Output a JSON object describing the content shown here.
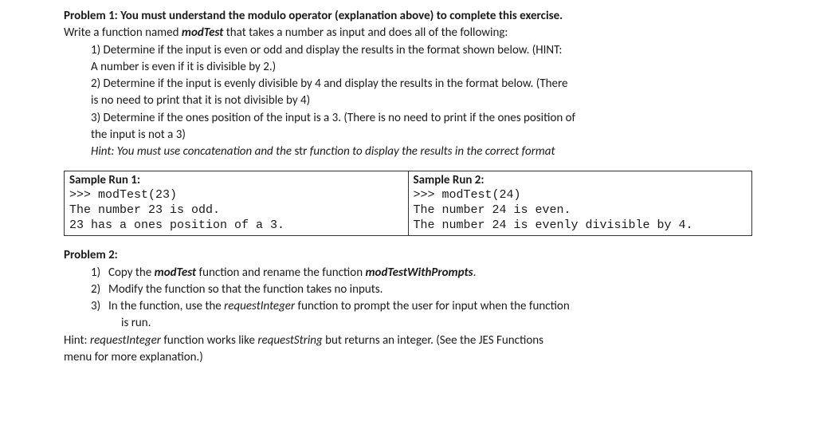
{
  "p1": {
    "title_lead": "Problem 1:  ",
    "title_rest": "You must understand the modulo operator (explanation above) to complete this exercise.",
    "intro_a": "Write a function named ",
    "intro_fn": "modTest",
    "intro_b": " that takes a number as input and does all of the following:",
    "step1a": "1) Determine if the input is even or odd and display the results in the format shown below.  (HINT:",
    "step1b": "A number is even if it is divisible by 2.)",
    "step2a": "2) Determine if the input is evenly divisible by 4 and display the results in the format below. (There",
    "step2b": "is no need to print that it is not divisible by 4)",
    "step3a": "3) Determine if the ones position of the input is a 3. (There is no need to print if the ones position of",
    "step3b": "the input is not a 3)",
    "hint_a": "Hint: You must use concatenation and the ",
    "hint_str": "str",
    "hint_b": " function to display the results in the correct format"
  },
  "samples": {
    "s1": {
      "title": "Sample Run 1:",
      "l1": ">>> modTest(23)",
      "l2": "The number 23 is odd.",
      "l3": "23 has a ones position of a 3."
    },
    "s2": {
      "title": "Sample Run 2:",
      "l1": ">>>  modTest(24)",
      "l2": "The number 24 is even.",
      "l3": "The number 24 is evenly divisible by 4."
    }
  },
  "p2": {
    "title": "Problem 2:",
    "s1_num": "1)",
    "s1a": "Copy the ",
    "s1_fn1": "modTest",
    "s1b": " function and rename the function ",
    "s1_fn2": "modTestWithPrompts",
    "s1c": ".",
    "s2_num": "2)",
    "s2": "Modify the function so that the function takes no inputs.",
    "s3_num": "3)",
    "s3a": "In the function, use the ",
    "s3_fn": "requestInteger",
    "s3b": " function to prompt the user for input when the function",
    "s3c": "is run.",
    "hint_a": "Hint:  ",
    "hint_fn1": "requestInteger",
    "hint_b": " function works like ",
    "hint_fn2": "requestString",
    "hint_c": " but returns an integer.  (See the JES Functions",
    "hint_d": "menu for more explanation.)"
  }
}
